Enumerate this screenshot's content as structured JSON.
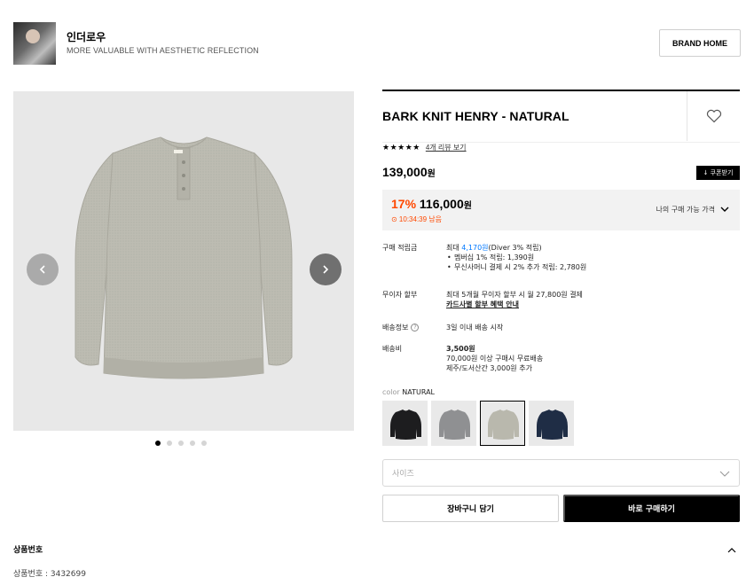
{
  "brand": {
    "name": "인더로우",
    "tagline": "MORE VALUABLE WITH AESTHETIC REFLECTION",
    "home_button": "BRAND HOME"
  },
  "gallery": {
    "slide_count": 5,
    "active_index": 0
  },
  "product": {
    "title": "BARK KNIT HENRY - NATURAL",
    "stars": "★★★★★",
    "rating_stars": 5,
    "review_link": "4개 리뷰 보기",
    "price": "139,000",
    "price_unit": "원",
    "coupon_button": "↓ 쿠폰받기"
  },
  "sale": {
    "percent": "17%",
    "price": "116,000",
    "unit": "원",
    "timer": "⊙ 10:34:39 남음",
    "my_price_label": "나의 구매 가능 가격"
  },
  "details": {
    "points_label": "구매 적립금",
    "points_prefix": "최대 ",
    "points_amount": "4,170원",
    "points_suffix": "(Diver 3% 적립)",
    "points_items": [
      "멤버십 1% 적립: 1,390원",
      "무신사머니 결제 시 2% 추가 적립: 2,780원"
    ],
    "installment_label": "무이자 할부",
    "installment_text": "최대 5개월 무이자 할부 시 월 27,800원 결제",
    "installment_link": "카드사별 할부 혜택 안내",
    "shipping_label": "배송정보",
    "shipping_help": "?",
    "shipping_text": "3일 이내 배송 시작",
    "fee_label": "배송비",
    "fee_amount": "3,500원",
    "fee_line1": "70,000원 이상 구매시 무료배송",
    "fee_line2": "제주/도서산간 3,000원 추가"
  },
  "colors": {
    "label": "color",
    "selected_name": "NATURAL",
    "options": [
      {
        "name": "black",
        "hex": "#1d1d1f"
      },
      {
        "name": "gray",
        "hex": "#8f9092"
      },
      {
        "name": "natural",
        "hex": "#b9b8ad"
      },
      {
        "name": "navy",
        "hex": "#1f2d45"
      }
    ],
    "selected_index": 2
  },
  "size_select": {
    "placeholder": "사이즈"
  },
  "actions": {
    "cart": "장바구니 담기",
    "buy": "바로 구매하기"
  },
  "product_number_section": {
    "title": "상품번호",
    "body": "상품번호 : 3432699"
  },
  "theme": {
    "accent": "#ff4800",
    "link_blue": "#0078ff"
  }
}
